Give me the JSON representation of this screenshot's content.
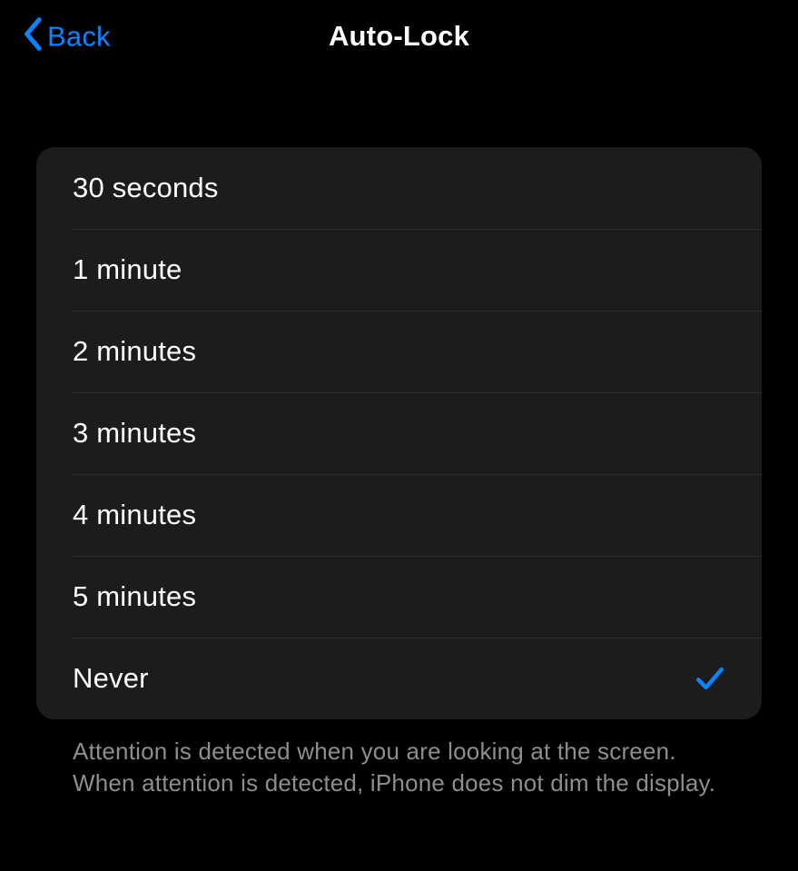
{
  "colors": {
    "accent": "#0a84ff",
    "background": "#000000",
    "cell": "#1c1c1e",
    "separator": "#3a3a3c",
    "footer_text": "#8d8d92"
  },
  "nav": {
    "back_label": "Back",
    "title": "Auto-Lock"
  },
  "options": [
    {
      "label": "30 seconds",
      "selected": false
    },
    {
      "label": "1 minute",
      "selected": false
    },
    {
      "label": "2 minutes",
      "selected": false
    },
    {
      "label": "3 minutes",
      "selected": false
    },
    {
      "label": "4 minutes",
      "selected": false
    },
    {
      "label": "5 minutes",
      "selected": false
    },
    {
      "label": "Never",
      "selected": true
    }
  ],
  "footer": "Attention is detected when you are looking at the screen. When attention is detected, iPhone does not dim the display."
}
